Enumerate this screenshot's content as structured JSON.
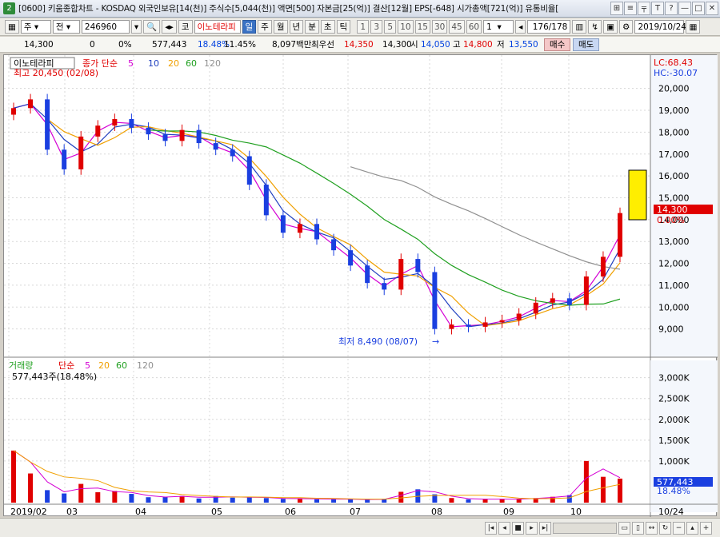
{
  "window": {
    "number": "2",
    "title": "[0600] 키움종합차트 - KOSDAQ 외국인보유[14(천)] 주식수[5,044(천)] 액면[500] 자본금[25(억)] 결산[12월] EPS[-648] 시가총액[721(억)] 유통비율[",
    "buttons": [
      "⊞",
      "≡",
      "╤",
      "T",
      "?",
      "—",
      "□",
      "✕"
    ]
  },
  "toolbar": {
    "period": "주",
    "prev": "전",
    "code": "246960",
    "market": "코",
    "name": "이노테라피",
    "tabs": [
      "일",
      "주",
      "월",
      "년",
      "분",
      "초",
      "틱"
    ],
    "active_tab": "일",
    "intervals": [
      "1",
      "3",
      "5",
      "10",
      "15",
      "30",
      "45",
      "60"
    ],
    "interval_value": "1",
    "count": "176",
    "total": "/178",
    "date": "2019/10/24"
  },
  "info": {
    "price": "14,300",
    "change": "0",
    "change_pct": "0%",
    "volume": "577,443",
    "vol_pct": "18.48%",
    "turnover": "11.45%",
    "amount": "8,097백만",
    "best_ask_label": "최우선",
    "best_ask": "14,350",
    "best_bid": "14,300",
    "open_label": "시",
    "open": "14,050",
    "high_label": "고",
    "high": "14,800",
    "low_label": "저",
    "low": "13,550",
    "buy_label": "매수",
    "sell_label": "매도"
  },
  "price_panel": {
    "legend_name": "이노테라피",
    "legend_ma": "종가 단순",
    "ma_periods": [
      "5",
      "10",
      "20",
      "60",
      "120"
    ],
    "high_label": "최고 20,450 (02/08)",
    "low_label": "최저 8,490 (08/07)",
    "lc": "LC:68.43",
    "hc": "HC:-30.07",
    "current_price": "14,300",
    "current_pct": "0.00%",
    "y_ticks": [
      "20,000",
      "19,000",
      "18,000",
      "17,000",
      "16,000",
      "15,000",
      "14,000",
      "13,000",
      "12,000",
      "11,000",
      "10,000",
      "9,000"
    ]
  },
  "volume_panel": {
    "legend_name": "거래량",
    "legend_ma": "단순",
    "ma_periods": [
      "5",
      "20",
      "60",
      "120"
    ],
    "value_label": "577,443주(18.48%)",
    "current": "577,443",
    "current_pct": "18.48%",
    "y_ticks": [
      "3,000K",
      "2,500K",
      "2,000K",
      "1,500K",
      "1,000K"
    ]
  },
  "x_axis": {
    "labels": [
      "2019/02",
      "03",
      "04",
      "05",
      "06",
      "07",
      "08",
      "09",
      "10",
      "10/24"
    ]
  },
  "colors": {
    "up": "#e00000",
    "down": "#1a3fe0",
    "ma5": "#d400d4",
    "ma10": "#2040c0",
    "ma20": "#f0a000",
    "ma60": "#20a020",
    "ma120": "#909090",
    "marker": "#ffee00"
  },
  "chart_data": {
    "type": "candlestick",
    "dates": [
      "02/01",
      "02/08",
      "02/15",
      "02/22",
      "03/04",
      "03/11",
      "03/18",
      "03/25",
      "04/01",
      "04/08",
      "04/15",
      "04/22",
      "05/02",
      "05/09",
      "05/16",
      "05/23",
      "06/03",
      "06/10",
      "06/17",
      "06/24",
      "07/01",
      "07/08",
      "07/15",
      "07/22",
      "08/01",
      "08/07",
      "08/14",
      "08/21",
      "09/02",
      "09/09",
      "09/16",
      "09/23",
      "10/01",
      "10/08",
      "10/15",
      "10/21",
      "10/24"
    ],
    "close": [
      19100,
      19500,
      17200,
      16300,
      17800,
      18300,
      18600,
      18200,
      17900,
      17600,
      18100,
      17500,
      17200,
      16900,
      15600,
      14200,
      13400,
      13800,
      13100,
      12600,
      11900,
      11100,
      10800,
      12200,
      11600,
      9000,
      9200,
      9100,
      9300,
      9400,
      9700,
      10200,
      10400,
      10100,
      11400,
      12300,
      14300
    ],
    "volume": [
      1250,
      700,
      300,
      220,
      450,
      250,
      280,
      210,
      130,
      140,
      160,
      100,
      160,
      120,
      140,
      110,
      90,
      100,
      80,
      90,
      80,
      70,
      90,
      260,
      320,
      200,
      110,
      80,
      90,
      80,
      90,
      110,
      140,
      180,
      1000,
      620,
      577
    ],
    "volume_unit": "K",
    "period_high": {
      "value": 20450,
      "date": "02/08"
    },
    "period_low": {
      "value": 8490,
      "date": "08/07"
    },
    "ylim": [
      8000,
      20500
    ],
    "volume_ylim": [
      0,
      3300
    ]
  }
}
